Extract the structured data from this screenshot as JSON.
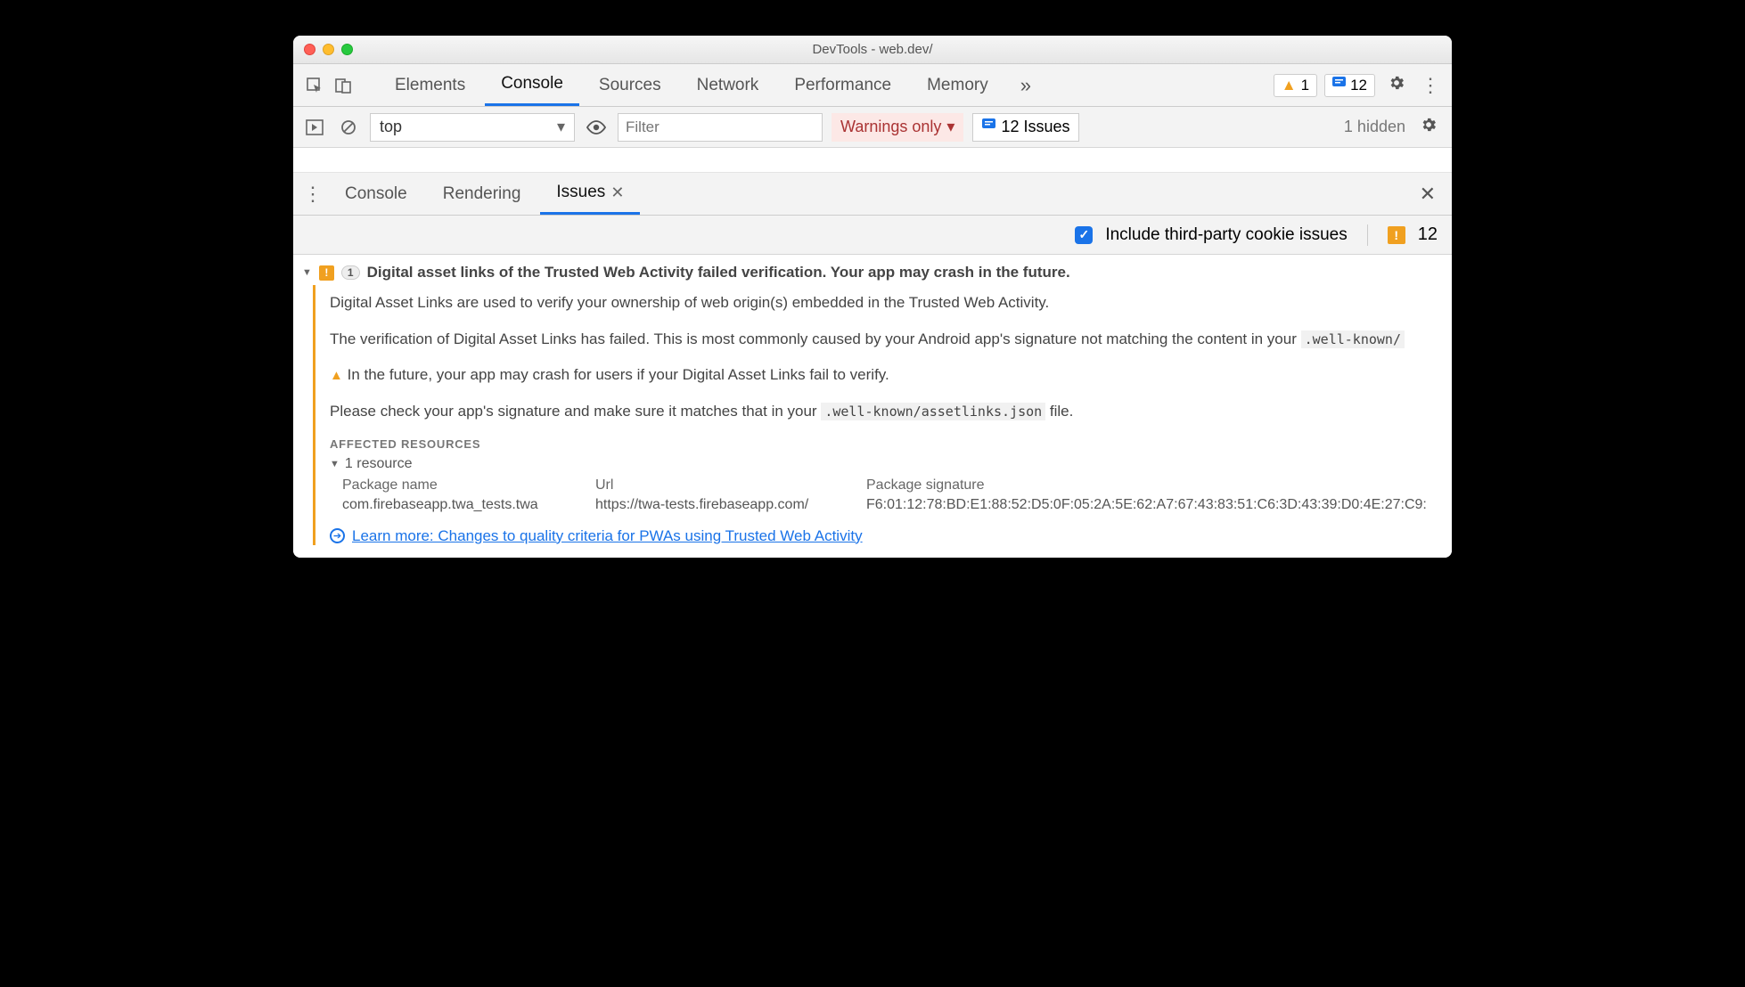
{
  "window": {
    "title": "DevTools - web.dev/"
  },
  "mainTabs": {
    "items": [
      "Elements",
      "Console",
      "Sources",
      "Network",
      "Performance",
      "Memory"
    ],
    "activeIndex": 1
  },
  "badges": {
    "warnings": "1",
    "messages": "12"
  },
  "toolbar": {
    "context": "top",
    "filterPlaceholder": "Filter",
    "levelLabel": "Warnings only",
    "issuesLabel": "12 Issues",
    "hiddenLabel": "1 hidden"
  },
  "drawerTabs": {
    "items": [
      "Console",
      "Rendering",
      "Issues"
    ],
    "activeIndex": 2
  },
  "options": {
    "includeThirdPartyLabel": "Include third-party cookie issues",
    "issueCount": "12"
  },
  "issue": {
    "count": "1",
    "title": "Digital asset links of the Trusted Web Activity failed verification. Your app may crash in the future.",
    "para1": "Digital Asset Links are used to verify your ownership of web origin(s) embedded in the Trusted Web Activity.",
    "para2_pre": "The verification of Digital Asset Links has failed. This is most commonly caused by your Android app's signature not matching the content in your ",
    "para2_code": ".well-known/",
    "warnLine": "In the future, your app may crash for users if your Digital Asset Links fail to verify.",
    "para3_pre": "Please check your app's signature and make sure it matches that in your ",
    "para3_code": ".well-known/assetlinks.json",
    "para3_post": " file.",
    "affectedLabel": "AFFECTED RESOURCES",
    "resourceSummary": "1 resource",
    "table": {
      "h1": "Package name",
      "h2": "Url",
      "h3": "Package signature",
      "c1": "com.firebaseapp.twa_tests.twa",
      "c2": "https://twa-tests.firebaseapp.com/",
      "c3": "F6:01:12:78:BD:E1:88:52:D5:0F:05:2A:5E:62:A7:67:43:83:51:C6:3D:43:39:D0:4E:27:C9:"
    },
    "learnMore": "Learn more: Changes to quality criteria for PWAs using Trusted Web Activity"
  }
}
